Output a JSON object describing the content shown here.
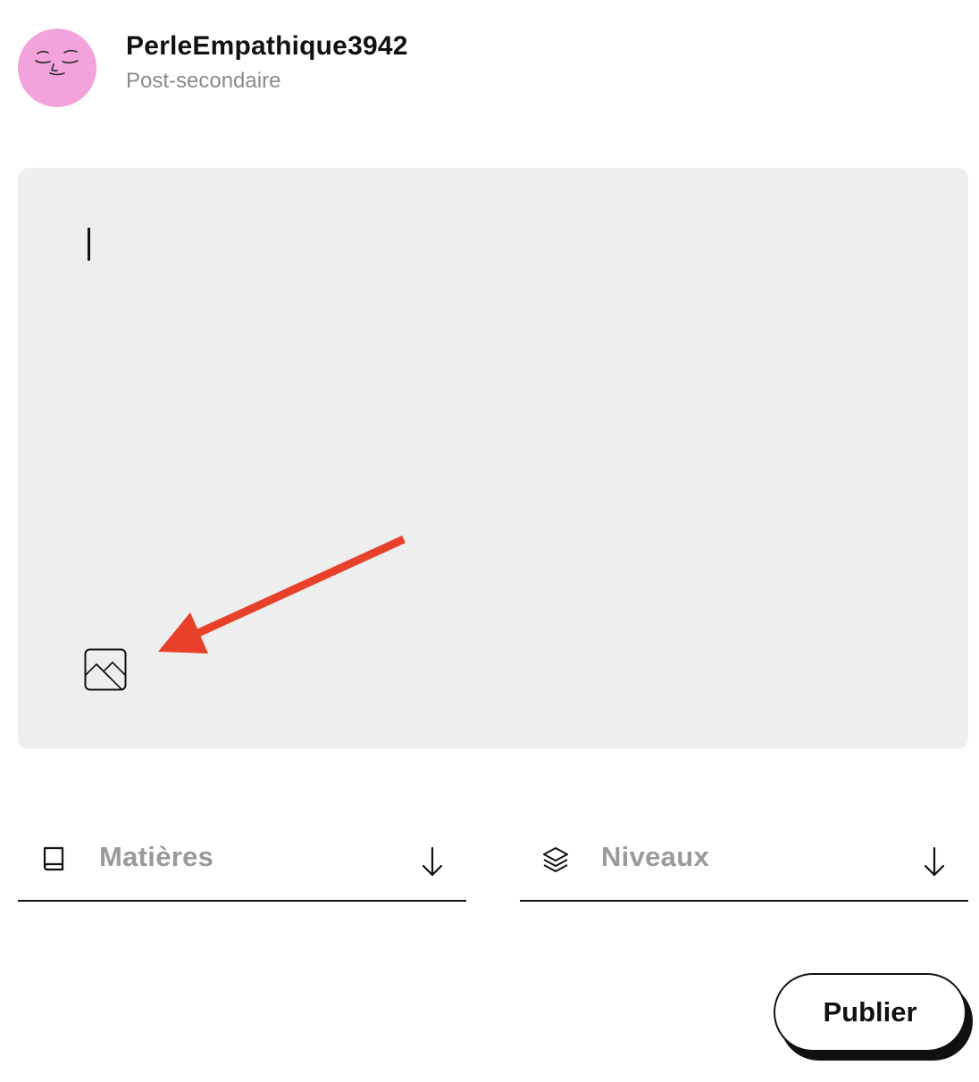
{
  "user": {
    "username": "PerleEmpathique3942",
    "level": "Post-secondaire",
    "avatar_icon": "sleepy-face-avatar",
    "avatar_color": "#f3a3dc"
  },
  "editor": {
    "text_value": "",
    "image_button_icon": "image-icon"
  },
  "annotation": {
    "arrow_color": "#e8412b",
    "points_to": "image-button"
  },
  "filters": {
    "subjects": {
      "label": "Matières",
      "icon": "book-icon",
      "chevron_icon": "arrow-down-icon"
    },
    "levels": {
      "label": "Niveaux",
      "icon": "layers-icon",
      "chevron_icon": "arrow-down-icon"
    }
  },
  "actions": {
    "publish_label": "Publier"
  }
}
